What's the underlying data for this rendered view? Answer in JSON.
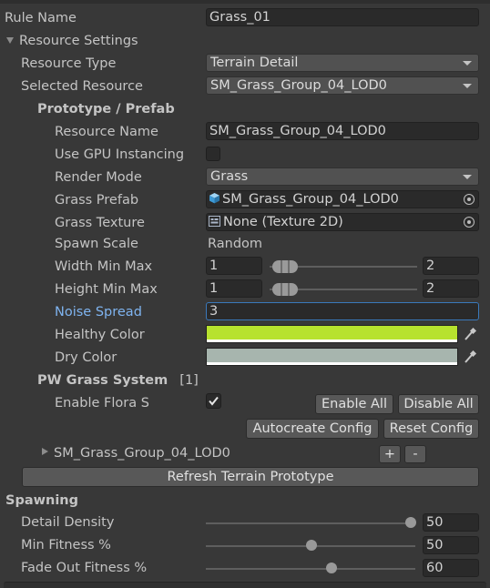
{
  "rule_name": {
    "label": "Rule Name",
    "value": "Grass_01"
  },
  "resource_settings": {
    "header": "Resource Settings",
    "resource_type": {
      "label": "Resource Type",
      "value": "Terrain Detail"
    },
    "selected_resource": {
      "label": "Selected Resource",
      "value": "SM_Grass_Group_04_LOD0"
    }
  },
  "prototype": {
    "header": "Prototype / Prefab",
    "resource_name": {
      "label": "Resource Name",
      "value": "SM_Grass_Group_04_LOD0"
    },
    "gpu_instancing": {
      "label": "Use GPU Instancing",
      "checked": false
    },
    "render_mode": {
      "label": "Render Mode",
      "value": "Grass"
    },
    "grass_prefab": {
      "label": "Grass Prefab",
      "value": "SM_Grass_Group_04_LOD0"
    },
    "grass_texture": {
      "label": "Grass Texture",
      "value": "None (Texture 2D)"
    },
    "spawn_scale": {
      "label": "Spawn Scale",
      "value": "Random"
    },
    "width_min_max": {
      "label": "Width Min Max",
      "min": "1",
      "max": "2"
    },
    "height_min_max": {
      "label": "Height Min Max",
      "min": "1",
      "max": "2"
    },
    "noise_spread": {
      "label": "Noise Spread",
      "value": "3"
    },
    "healthy_color": {
      "label": "Healthy Color",
      "color": "#b7e22e"
    },
    "dry_color": {
      "label": "Dry Color",
      "color": "#a7b5ae"
    }
  },
  "pw_grass": {
    "header": "PW Grass System",
    "count": "[1]",
    "enable_flora": {
      "label": "Enable Flora S",
      "checked": true
    },
    "enable_all": "Enable All",
    "disable_all": "Disable All",
    "autocreate": "Autocreate Config",
    "reset": "Reset Config",
    "item": "SM_Grass_Group_04_LOD0",
    "plus": "+",
    "minus": "-"
  },
  "refresh_button": "Refresh Terrain Prototype",
  "spawning": {
    "header": "Spawning",
    "detail_density": {
      "label": "Detail Density",
      "value": "50",
      "fraction": 1.0
    },
    "min_fitness": {
      "label": "Min Fitness %",
      "value": "50",
      "fraction": 0.5
    },
    "fade_out_fitness": {
      "label": "Fade Out Fitness %",
      "value": "60",
      "fraction": 0.6
    }
  }
}
